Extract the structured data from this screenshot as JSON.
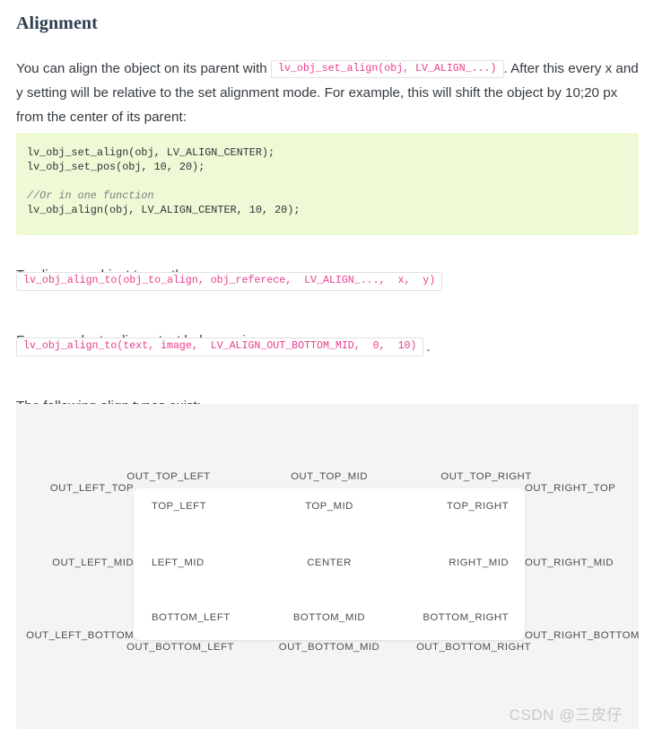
{
  "heading": "Alignment",
  "paragraphs": {
    "intro_before": "You can align the object on its parent with ",
    "intro_code": "lv_obj_set_align(obj, LV_ALIGN_...)",
    "intro_after": ". After this every x and y setting will be relative to the set alignment mode. For example, this will shift the object by 10;20 px from the center of its parent:",
    "align_to": "To align one object to another use:",
    "example": "For example, to align a text below an image:",
    "types": "The following align types exist:"
  },
  "code_block": {
    "language": "c",
    "background_color": "#eef9d5",
    "lines": [
      {
        "type": "code",
        "text": "lv_obj_set_align(obj, LV_ALIGN_CENTER);"
      },
      {
        "type": "code",
        "text": "lv_obj_set_pos(obj, 10, 20);"
      },
      {
        "type": "blank",
        "text": ""
      },
      {
        "type": "comment",
        "text": "//Or in one function"
      },
      {
        "type": "code",
        "text": "lv_obj_align(obj, LV_ALIGN_CENTER, 10, 20);"
      }
    ]
  },
  "inline_code_lines": {
    "align_to": "lv_obj_align_to(obj_to_align, obj_referece,  LV_ALIGN_...,  x,  y)",
    "example": "lv_obj_align_to(text, image,  LV_ALIGN_OUT_BOTTOM_MID,  0,  10)",
    "example_trailing": "."
  },
  "align_diagram": {
    "panel_background": "#f4f4f4",
    "inner_box_background": "#ffffff",
    "label_color": "#4a4f54",
    "outside_labels": {
      "out_top_left": "OUT_TOP_LEFT",
      "out_top_mid": "OUT_TOP_MID",
      "out_top_right": "OUT_TOP_RIGHT",
      "out_left_top": "OUT_LEFT_TOP",
      "out_right_top": "OUT_RIGHT_TOP",
      "out_left_mid": "OUT_LEFT_MID",
      "out_right_mid": "OUT_RIGHT_MID",
      "out_left_bottom": "OUT_LEFT_BOTTOM",
      "out_right_bottom": "OUT_RIGHT_BOTTOM",
      "out_bottom_left": "OUT_BOTTOM_LEFT",
      "out_bottom_mid": "OUT_BOTTOM_MID",
      "out_bottom_right": "OUT_BOTTOM_RIGHT"
    },
    "inside_labels": {
      "top_left": "TOP_LEFT",
      "top_mid": "TOP_MID",
      "top_right": "TOP_RIGHT",
      "left_mid": "LEFT_MID",
      "center": "CENTER",
      "right_mid": "RIGHT_MID",
      "bottom_left": "BOTTOM_LEFT",
      "bottom_mid": "BOTTOM_MID",
      "bottom_right": "BOTTOM_RIGHT"
    }
  },
  "watermark": "CSDN @三皮仔"
}
